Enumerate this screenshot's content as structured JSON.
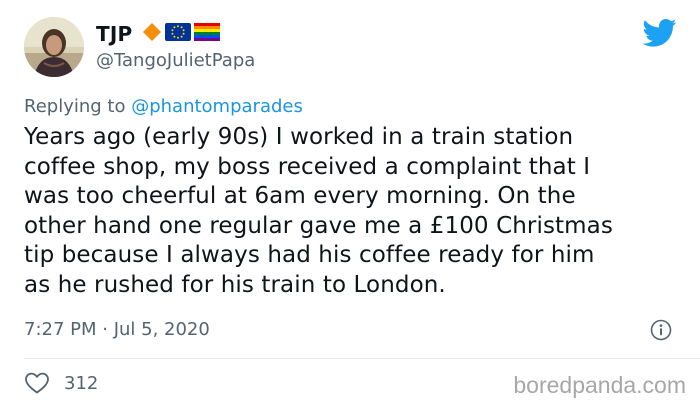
{
  "author": {
    "display_name": "TJP",
    "handle": "@TangoJulietPapa",
    "badges": [
      "orange-diamond-icon",
      "eu-flag-icon",
      "rainbow-flag-icon"
    ]
  },
  "reply": {
    "prefix": "Replying to",
    "mention": "@phantomparades"
  },
  "tweet": {
    "lines": [
      "Years ago (early 90s) I worked in a train station",
      "coffee shop, my boss received a complaint that I",
      "was too cheerful at 6am every morning. On the",
      "other hand one regular gave me a £100 Christmas",
      "tip because I always had his coffee ready for him",
      "as he rushed for his train to London."
    ]
  },
  "meta": {
    "timestamp": "7:27 PM · Jul 5, 2020"
  },
  "actions": {
    "like_count": "312"
  },
  "watermark": "boredpanda.com",
  "colors": {
    "twitter_blue": "#1da1f2",
    "mention_blue": "#1b95e0",
    "secondary_text": "#536471",
    "divider": "#e6ecf0"
  },
  "icons": {
    "brand": "twitter-bird-icon",
    "info": "info-icon",
    "like": "heart-icon"
  }
}
